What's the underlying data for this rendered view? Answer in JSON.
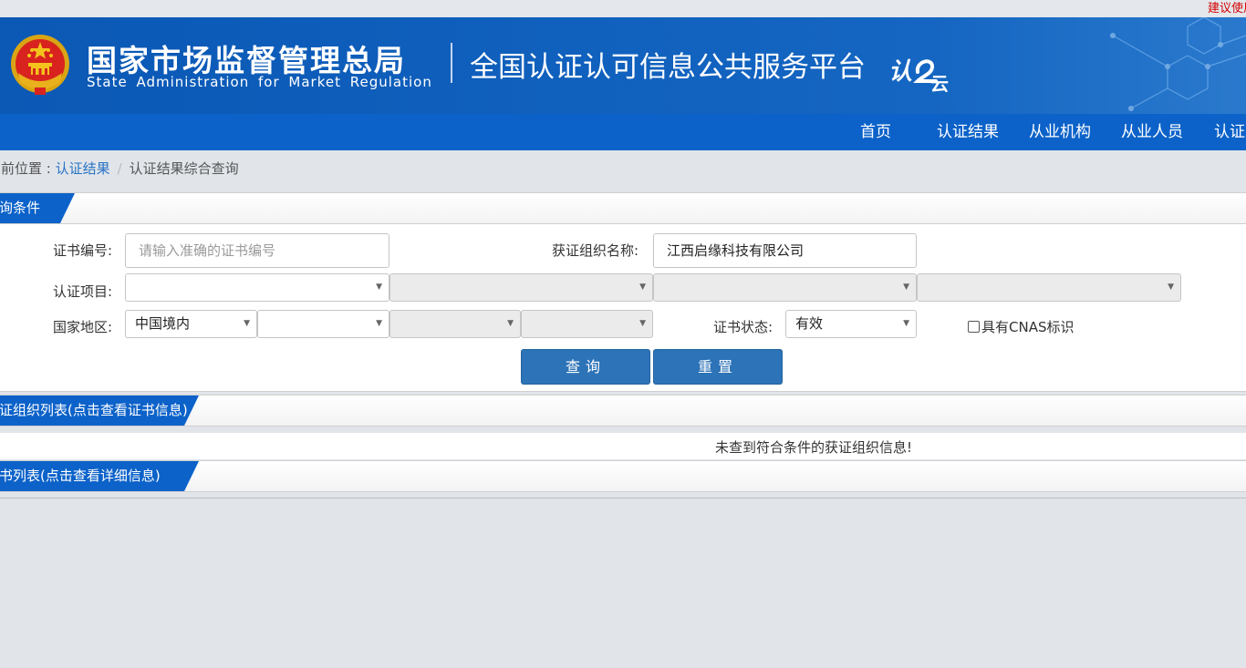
{
  "top_notice": "建议使用",
  "header": {
    "agency_cn": "国家市场监督管理总局",
    "agency_en": "State Administration  for  Market Regulation",
    "platform_title": "全国认证认可信息公共服务平台",
    "cloud_logo_text": [
      "认",
      "云"
    ],
    "colors": {
      "banner": "#0b58b5",
      "nav": "#0c62c9"
    }
  },
  "nav": {
    "items": [
      "首页",
      "认证结果",
      "从业机构",
      "从业人员",
      "认证"
    ]
  },
  "breadcrumb": {
    "prefix": "当前位置 : ",
    "link": "认证结果",
    "separator": "/",
    "current": "认证结果综合查询"
  },
  "query_section": {
    "title": "查询条件"
  },
  "form": {
    "cert_number": {
      "label": "证书编号:",
      "placeholder": "请输入准确的证书编号",
      "value": ""
    },
    "org_name": {
      "label": "获证组织名称:",
      "value": "江西启缘科技有限公司"
    },
    "cert_project": {
      "label": "认证项目:",
      "selects": [
        "",
        "",
        "",
        ""
      ]
    },
    "region": {
      "label": "国家地区:",
      "selects": [
        "中国境内",
        "",
        "",
        ""
      ]
    },
    "cert_status": {
      "label": "证书状态:",
      "value": "有效"
    },
    "cnas": {
      "label": "具有CNAS标识",
      "checked": false
    },
    "query_button": "查询",
    "reset_button": "重置"
  },
  "org_list": {
    "title": "获证组织列表(点击查看证书信息)",
    "empty_message": "未查到符合条件的获证组织信息!"
  },
  "cert_list": {
    "title": "证书列表(点击查看详细信息)"
  }
}
